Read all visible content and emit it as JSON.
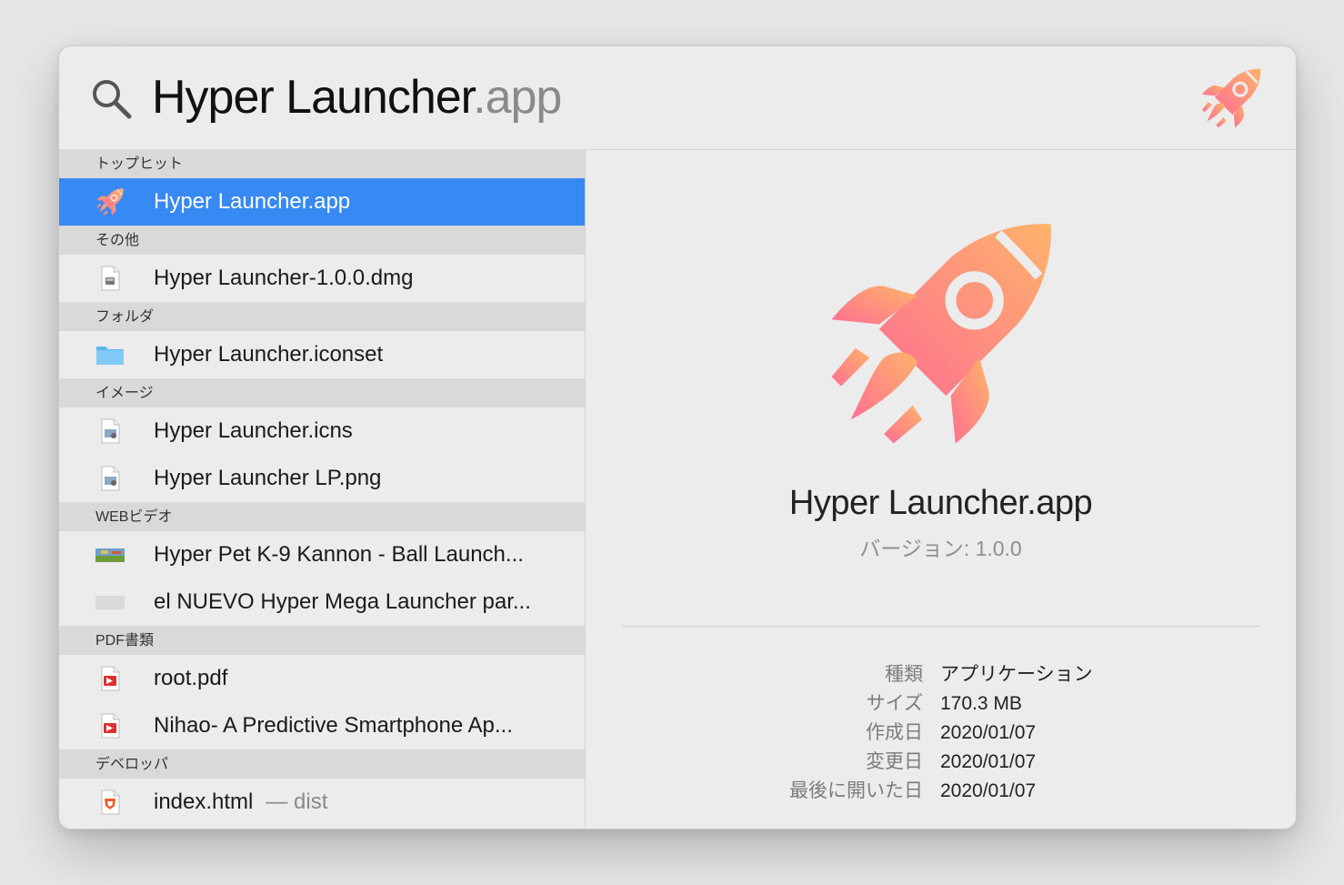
{
  "search": {
    "typed": "Hyper Launcher",
    "completion": ".app"
  },
  "results": {
    "sections": [
      {
        "header": "トップヒット",
        "items": [
          {
            "label": "Hyper Launcher.app",
            "icon": "rocket-icon",
            "selected": true
          }
        ]
      },
      {
        "header": "その他",
        "items": [
          {
            "label": "Hyper Launcher-1.0.0.dmg",
            "icon": "disk-image-icon"
          }
        ]
      },
      {
        "header": "フォルダ",
        "items": [
          {
            "label": "Hyper Launcher.iconset",
            "icon": "folder-icon"
          }
        ]
      },
      {
        "header": "イメージ",
        "items": [
          {
            "label": "Hyper Launcher.icns",
            "icon": "image-file-icon"
          },
          {
            "label": "Hyper Launcher LP.png",
            "icon": "image-file-icon"
          }
        ]
      },
      {
        "header": "WEBビデオ",
        "items": [
          {
            "label": "Hyper Pet K-9 Kannon - Ball Launch...",
            "icon": "video-thumbnail-icon"
          },
          {
            "label": "el NUEVO Hyper Mega Launcher par...",
            "icon": "video-placeholder-icon"
          }
        ]
      },
      {
        "header": "PDF書類",
        "items": [
          {
            "label": "root.pdf",
            "icon": "pdf-icon"
          },
          {
            "label": "Nihao- A Predictive Smartphone Ap...",
            "icon": "pdf-icon"
          }
        ]
      },
      {
        "header": "デベロッパ",
        "items": [
          {
            "label": "index.html",
            "sublabel": "— dist",
            "icon": "html-file-icon"
          }
        ]
      }
    ]
  },
  "preview": {
    "title": "Hyper Launcher.app",
    "version": "バージョン: 1.0.0",
    "info": [
      {
        "key": "種類",
        "value": "アプリケーション"
      },
      {
        "key": "サイズ",
        "value": "170.3 MB"
      },
      {
        "key": "作成日",
        "value": "2020/01/07"
      },
      {
        "key": "変更日",
        "value": "2020/01/07"
      },
      {
        "key": "最後に開いた日",
        "value": "2020/01/07"
      }
    ]
  },
  "colors": {
    "selection": "#3789f3",
    "rocket_start": "#ff6f91",
    "rocket_end": "#ffb36b"
  }
}
